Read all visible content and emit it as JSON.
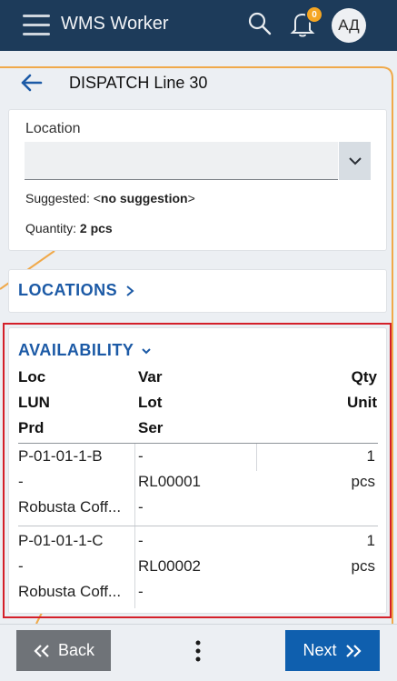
{
  "app": {
    "title": "WMS Worker",
    "notification_count": "0",
    "avatar_initials": "АД"
  },
  "page": {
    "title": "DISPATCH Line 30"
  },
  "location_card": {
    "label": "Location",
    "value": "",
    "suggested_prefix": "Suggested: <",
    "suggested_value": "no suggestion",
    "suggested_suffix": ">",
    "quantity_prefix": "Quantity: ",
    "quantity_value": "2 pcs"
  },
  "locations_section": {
    "title": "LOCATIONS"
  },
  "availability": {
    "title": "AVAILABILITY",
    "headers": {
      "col1": [
        "Loc",
        "LUN",
        "Prd"
      ],
      "col2": [
        "Var",
        "Lot",
        "Ser"
      ],
      "col3": [
        "Qty",
        "Unit"
      ]
    },
    "rows": [
      {
        "loc": "P-01-01-1-B",
        "lun": "-",
        "prd": "Robusta Coff...",
        "var": "-",
        "lot": "RL00001",
        "ser": "-",
        "qty": "1",
        "unit": "pcs"
      },
      {
        "loc": "P-01-01-1-C",
        "lun": "-",
        "prd": "Robusta Coff...",
        "var": "-",
        "lot": "RL00002",
        "ser": "-",
        "qty": "1",
        "unit": "pcs"
      }
    ]
  },
  "footer": {
    "back_label": "Back",
    "next_label": "Next"
  },
  "colors": {
    "appbar": "#1d3b5a",
    "accent": "#1c5aa6",
    "next_button": "#0f5fae",
    "back_button": "#6f7378",
    "badge": "#f5a623",
    "highlight": "#d4202a"
  }
}
